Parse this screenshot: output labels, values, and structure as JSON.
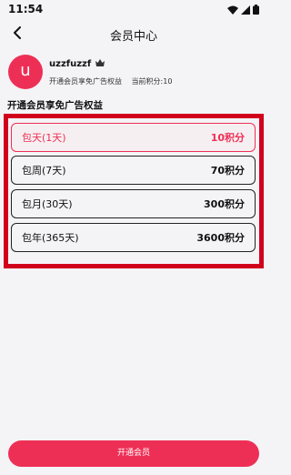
{
  "status_bar": {
    "time": "11:54",
    "icons": [
      "wifi-icon",
      "signal-icon",
      "battery-icon"
    ]
  },
  "header": {
    "title": "会员中心",
    "back_icon": "chevron-left-icon"
  },
  "user": {
    "avatar_letter": "u",
    "avatar_color": "#ee2f55",
    "username": "uzzfuzzf",
    "badge_icon": "crown-icon",
    "subtitle": "开通会员享免广告权益",
    "points": "当前积分:10"
  },
  "section_title": "开通会员享免广告权益",
  "plans": [
    {
      "name": "包天(1天)",
      "price": "10积分",
      "selected": true
    },
    {
      "name": "包周(7天)",
      "price": "70积分",
      "selected": false
    },
    {
      "name": "包月(30天)",
      "price": "300积分",
      "selected": false
    },
    {
      "name": "包年(365天)",
      "price": "3600积分",
      "selected": false
    }
  ],
  "cta_label": "开通会员",
  "colors": {
    "accent": "#ee2f55",
    "highlight_border": "#d1001b",
    "background": "#f4f3f6"
  }
}
